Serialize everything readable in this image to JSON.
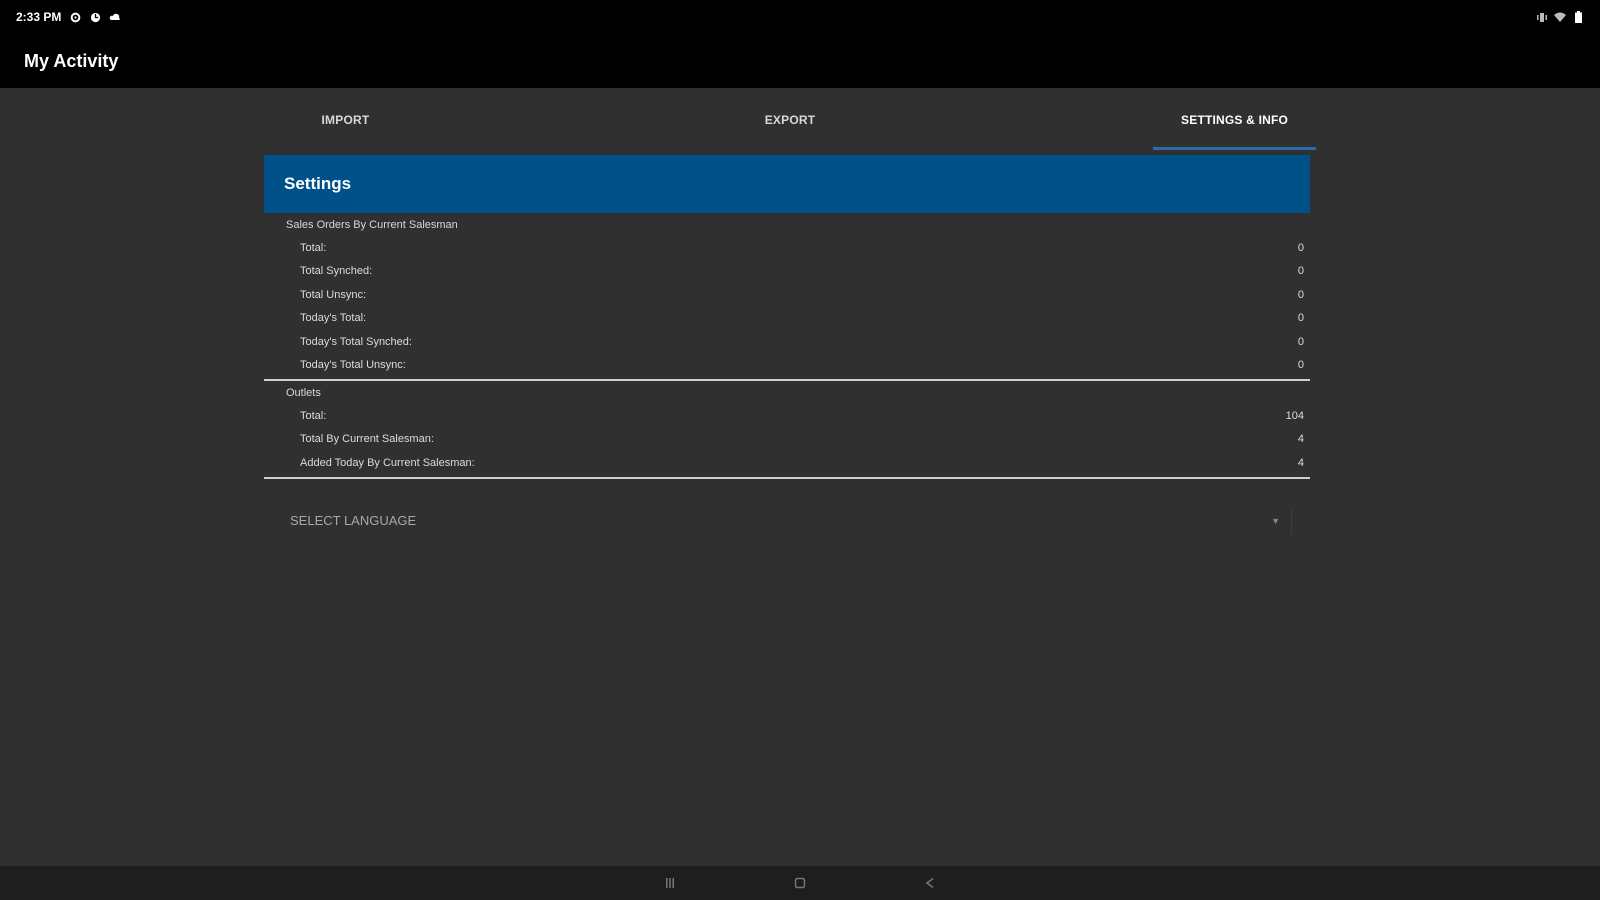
{
  "status_bar": {
    "time": "2:33 PM",
    "left_icons": [
      "gear-icon",
      "sync-icon",
      "cloud-icon"
    ],
    "right_icons": [
      "vibrate-icon",
      "wifi-icon",
      "battery-icon"
    ]
  },
  "app_bar": {
    "title": "My Activity"
  },
  "tabs": [
    {
      "label": "IMPORT",
      "active": false
    },
    {
      "label": "EXPORT",
      "active": false
    },
    {
      "label": "SETTINGS & INFO",
      "active": true
    }
  ],
  "settings": {
    "title": "Settings",
    "sales_orders": {
      "title": "Sales Orders By Current Salesman",
      "rows": [
        {
          "label": "Total:",
          "value": "0"
        },
        {
          "label": "Total Synched:",
          "value": "0"
        },
        {
          "label": "Total Unsync:",
          "value": "0"
        },
        {
          "label": "Today's Total:",
          "value": "0"
        },
        {
          "label": "Today's Total Synched:",
          "value": "0"
        },
        {
          "label": "Today's Total Unsync:",
          "value": "0"
        }
      ]
    },
    "outlets": {
      "title": "Outlets",
      "rows": [
        {
          "label": "Total:",
          "value": "104"
        },
        {
          "label": "Total By Current Salesman:",
          "value": "4"
        },
        {
          "label": "Added Today By Current Salesman:",
          "value": "4"
        }
      ]
    },
    "language_select": {
      "placeholder": "SELECT LANGUAGE"
    }
  },
  "colors": {
    "background": "#303030",
    "header_bg": "#00508a",
    "tab_indicator": "#2b6ba8",
    "bar_bg": "#000000"
  }
}
